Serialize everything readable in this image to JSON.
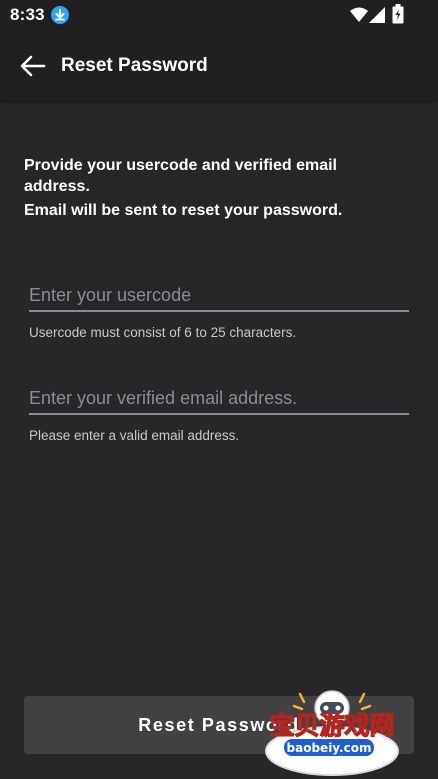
{
  "status_bar": {
    "time": "8:33",
    "icons": [
      "download-icon",
      "wifi-icon",
      "signal-icon",
      "battery-icon"
    ]
  },
  "app_bar": {
    "title": "Reset Password",
    "back_icon": "arrow-left-icon"
  },
  "instructions": {
    "line1": "Provide your usercode and verified email address.",
    "line2": "Email will be sent to reset your password."
  },
  "form": {
    "usercode": {
      "value": "",
      "placeholder": "Enter your usercode",
      "helper": "Usercode must consist of 6 to 25 characters."
    },
    "email": {
      "value": "",
      "placeholder": "Enter your verified email address.",
      "helper": "Please enter a valid email address."
    },
    "submit_label": "Reset Password"
  },
  "watermark": {
    "text": "宝贝游戏网",
    "url": "baobeiy.com"
  },
  "colors": {
    "background": "#27272a",
    "app_bar": "#202022",
    "button": "#424244",
    "accent_download": "#2fa5f2",
    "underline": "#8c8c90"
  }
}
